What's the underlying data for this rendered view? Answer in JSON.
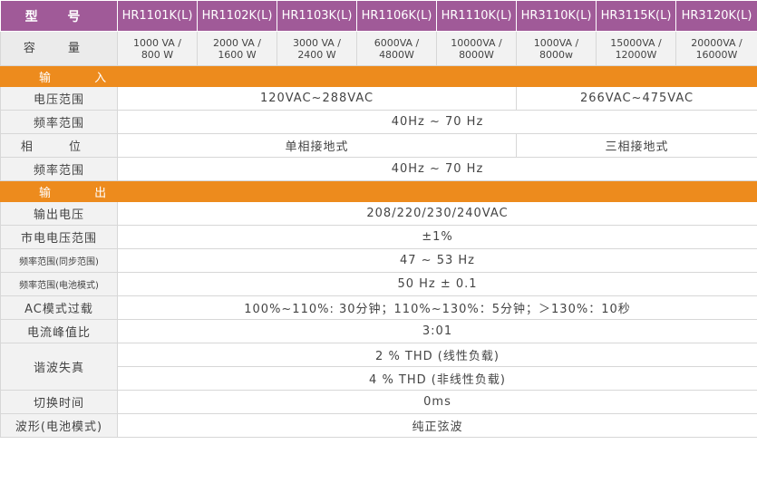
{
  "header": {
    "label": "型 号",
    "models": [
      "HR1101K(L)",
      "HR1102K(L)",
      "HR1103K(L)",
      "HR1106K(L)",
      "HR1110K(L)",
      "HR3110K(L)",
      "HR3115K(L)",
      "HR3120K(L)"
    ]
  },
  "capacity": {
    "label": "容 量",
    "values": [
      [
        "1000 VA /",
        "800 W"
      ],
      [
        "2000 VA /",
        "1600 W"
      ],
      [
        "3000 VA /",
        "2400 W"
      ],
      [
        "6000VA /",
        "4800W"
      ],
      [
        "10000VA /",
        "8000W"
      ],
      [
        "1000VA /",
        "8000w"
      ],
      [
        "15000VA /",
        "12000W"
      ],
      [
        "20000VA /",
        "16000W"
      ]
    ]
  },
  "input": {
    "title": "输 入",
    "voltage_range": {
      "label": "电压范围",
      "single": "120VAC~288VAC",
      "three": "266VAC~475VAC"
    },
    "freq_range": {
      "label": "频率范围",
      "value": "40Hz ~ 70 Hz"
    },
    "phase": {
      "label": "相 位",
      "single": "单相接地式",
      "three": "三相接地式"
    },
    "freq_range_2": {
      "label": "频率范围",
      "value": "40Hz ~ 70 Hz"
    }
  },
  "output": {
    "title": "输 出",
    "voltage": {
      "label": "输出电压",
      "value": "208/220/230/240VAC"
    },
    "mains_range": {
      "label": "市电电压范围",
      "value": "±1%"
    },
    "freq_sync": {
      "label": "频率范围(同步范围)",
      "value": "47 ~ 53 Hz"
    },
    "freq_batt": {
      "label": "频率范围(电池模式)",
      "value": "50 Hz ± 0.1"
    },
    "ac_overload": {
      "label": "AC模式过载",
      "value": "100%~110%: 30分钟；110%~130%：5分钟；＞130%：10秒"
    },
    "crest": {
      "label": "电流峰值比",
      "value": "3:01"
    },
    "thd": {
      "label": "谐波失真",
      "linear": "2 % THD (线性负载)",
      "nonlinear": "4 % THD (非线性负载)"
    },
    "transfer": {
      "label": "切换时间",
      "value": "0ms"
    },
    "waveform": {
      "label": "波形(电池模式)",
      "value": "纯正弦波"
    }
  }
}
